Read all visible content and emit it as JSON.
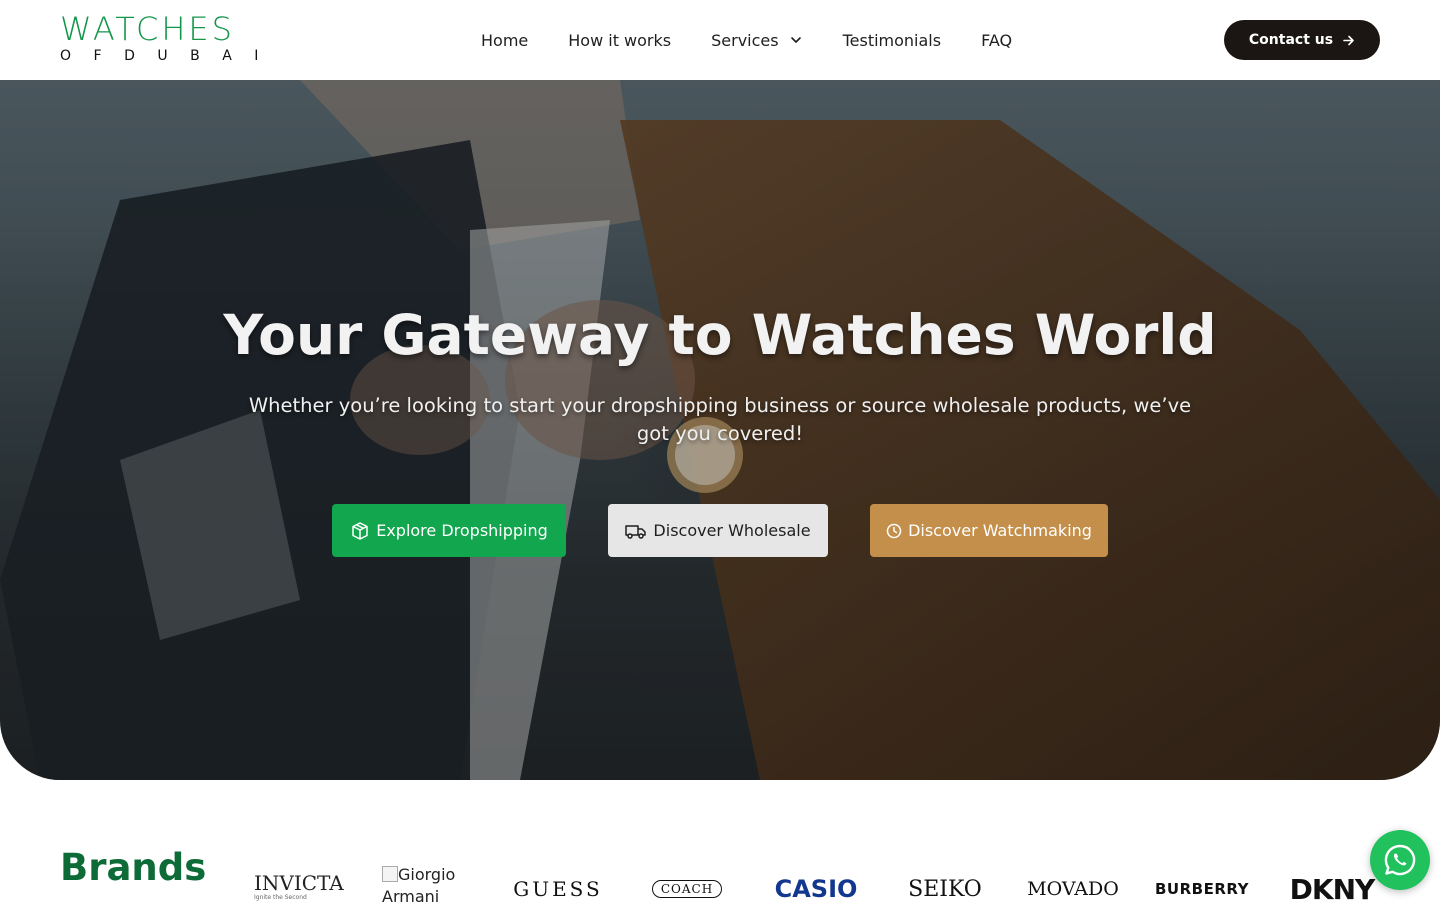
{
  "header": {
    "logo": {
      "line1": "WATCHES",
      "line2": "OFDUBAI"
    },
    "nav": [
      {
        "label": "Home"
      },
      {
        "label": "How it works"
      },
      {
        "label": "Services",
        "has_dropdown": true
      },
      {
        "label": "Testimonials"
      },
      {
        "label": "FAQ"
      }
    ],
    "contact_label": "Contact us"
  },
  "hero": {
    "title": "Your Gateway to Watches World",
    "subtitle": "Whether you’re looking to start your dropshipping business or source wholesale products, we’ve got you covered!",
    "buttons": {
      "dropshipping": "Explore Dropshipping",
      "wholesale": "Discover Wholesale",
      "watchmaking": "Discover Watchmaking"
    }
  },
  "brands": {
    "title": "Brands",
    "items": {
      "invicta": "INVICTA",
      "invicta_tag": "Ignite the Second",
      "armani_alt": "Giorgio Armani",
      "guess": "GUESS",
      "coach": "COACH",
      "casio": "CASIO",
      "seiko": "SEIKO",
      "movado": "MOVADO",
      "burberry": "BURBERRY",
      "dkny": "DKNY"
    }
  },
  "colors": {
    "brand_green": "#14964a",
    "dark_green": "#0d6b38",
    "dropshipping_button": "#12a64e",
    "wholesale_button": "#e6e6e6",
    "watchmaking_button": "#c48f4a",
    "contact_button": "#1b1513",
    "whatsapp": "#21c25e"
  },
  "icons": {
    "services_dropdown": "chevron-down-icon",
    "contact": "arrow-right-icon",
    "dropshipping": "package-icon",
    "wholesale": "truck-icon",
    "watchmaking": "clock-icon",
    "chat": "whatsapp-icon"
  }
}
